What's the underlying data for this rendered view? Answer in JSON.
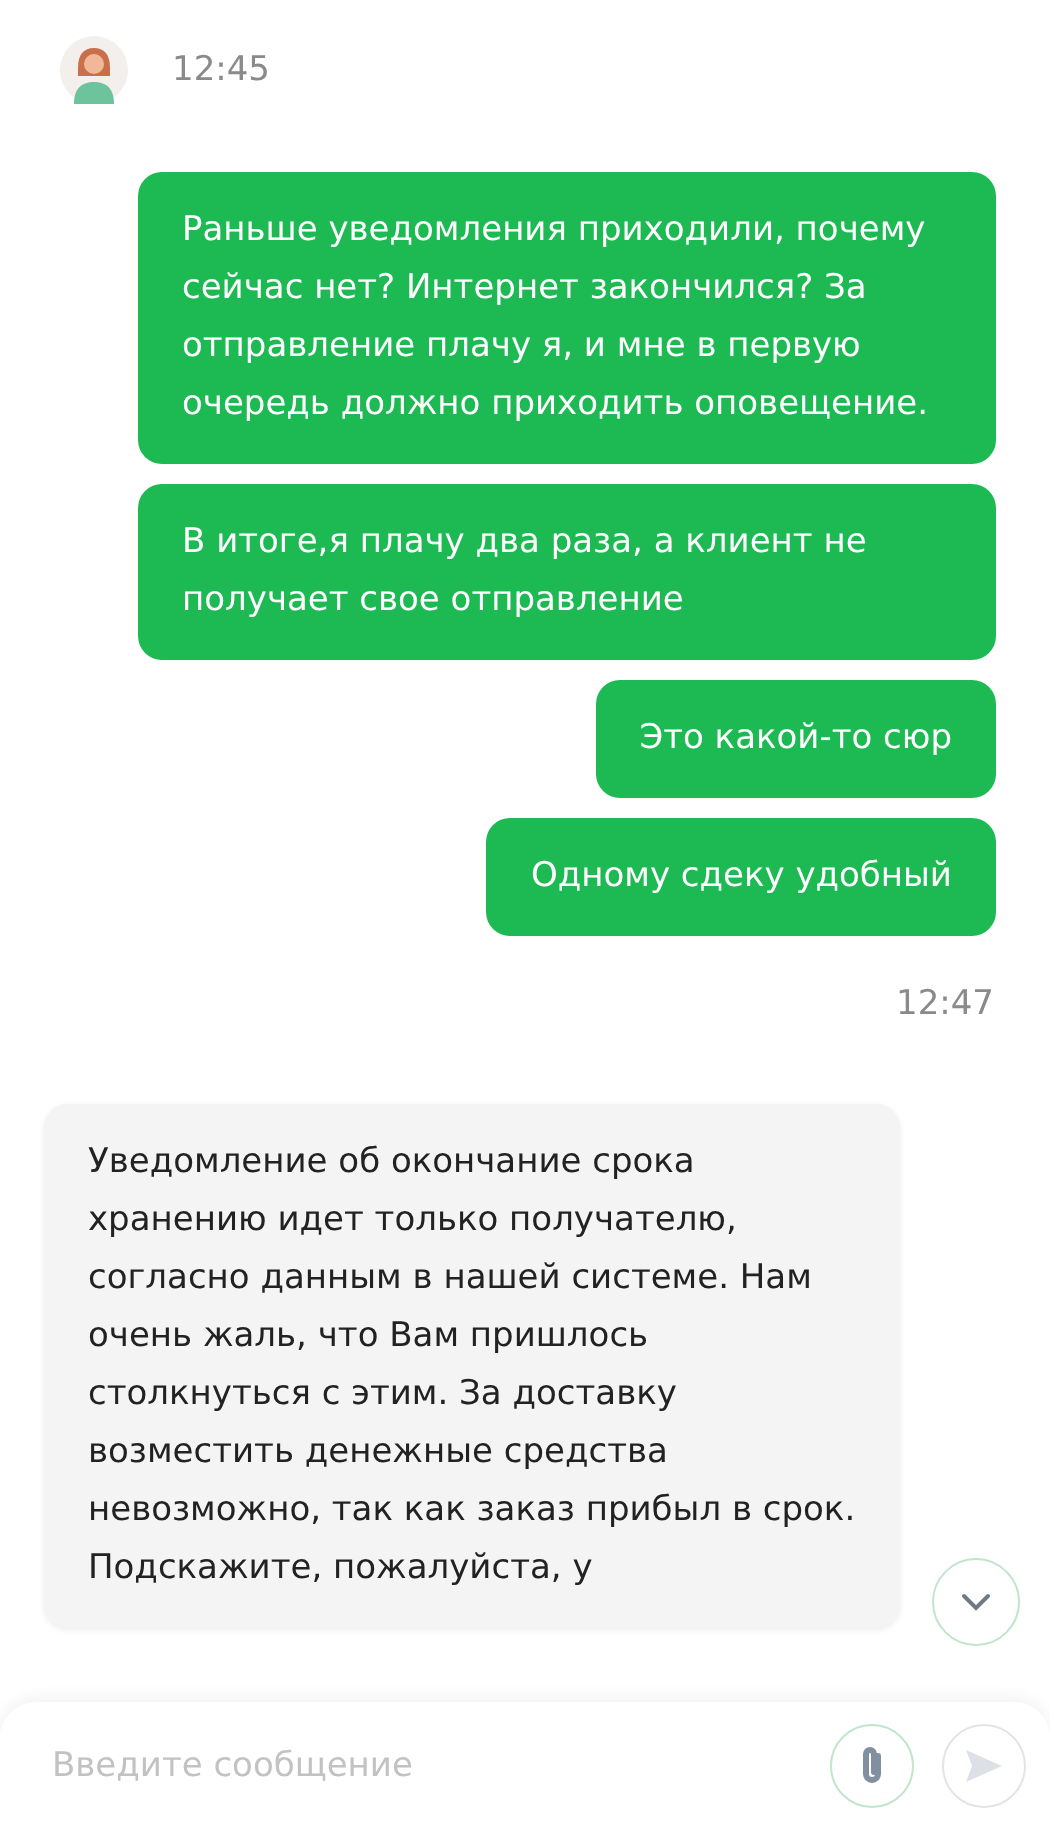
{
  "chat": {
    "items": [
      {
        "kind": "agent-time",
        "time": "12:45"
      },
      {
        "kind": "outgoing",
        "text": "Раньше уведомления приходили, почему сейчас нет? Интернет закончился? За отправление плачу я, и мне в первую очередь должно приходить оповещение."
      },
      {
        "kind": "outgoing",
        "text": "В итоге,я плачу два раза, а клиент не получает свое отправление"
      },
      {
        "kind": "outgoing",
        "text": "Это какой-то сюр"
      },
      {
        "kind": "outgoing",
        "text": "Одному сдеку удобный"
      },
      {
        "kind": "time",
        "time": "12:47"
      },
      {
        "kind": "incoming",
        "text": "Уведомление об окончание срока хранению идет только получателю, согласно данным в нашей системе. Нам очень жаль, что Вам пришлось столкнуться с этим. За доставку возместить денежные средства невозможно, так как заказ прибыл в срок. Подскажите, пожалуйста, у"
      }
    ]
  },
  "composer": {
    "placeholder": "Введите сообщение"
  }
}
